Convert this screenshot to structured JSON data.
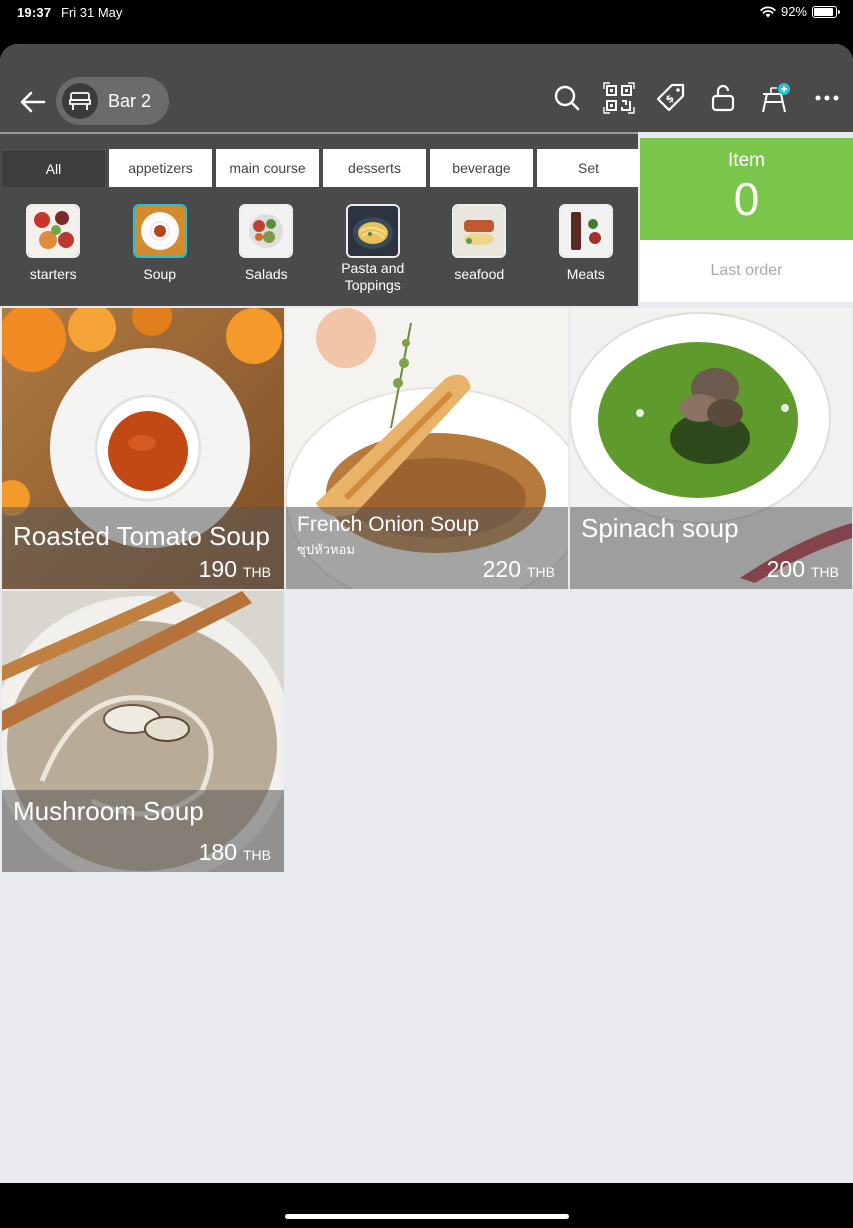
{
  "status": {
    "time": "19:37",
    "date": "Fri 31 May",
    "battery": "92%",
    "battery_level": 0.92
  },
  "header": {
    "table_name": "Bar 2",
    "icons": [
      "back-arrow-icon",
      "table-icon",
      "search-icon",
      "qr-code-icon",
      "discount-tag-icon",
      "unlock-icon",
      "add-table-icon",
      "more-icon"
    ]
  },
  "tabs": [
    "All",
    "appetizers",
    "main course",
    "desserts",
    "beverage",
    "Set"
  ],
  "active_tab": "All",
  "subcategories": [
    "starters",
    "Soup",
    "Salads",
    "Pasta and Toppings",
    "seafood",
    "Meats"
  ],
  "active_subcategory": "Soup",
  "order": {
    "title": "Item",
    "count": "0",
    "last_order_label": "Last order"
  },
  "products": [
    {
      "name": "Roasted Tomato Soup",
      "subtitle": "",
      "price": "190",
      "currency": "THB"
    },
    {
      "name": "French Onion Soup",
      "subtitle": "ซุปหัวหอม",
      "price": "220",
      "currency": "THB"
    },
    {
      "name": "Spinach soup",
      "subtitle": "",
      "price": "200",
      "currency": "THB"
    },
    {
      "name": "Mushroom Soup",
      "subtitle": "",
      "price": "180",
      "currency": "THB"
    }
  ],
  "colors": {
    "toolbar": "#4a4a4a",
    "accent_green": "#7ac64a",
    "active_subcat_border": "#22c2d8",
    "background": "#e9eaed"
  }
}
